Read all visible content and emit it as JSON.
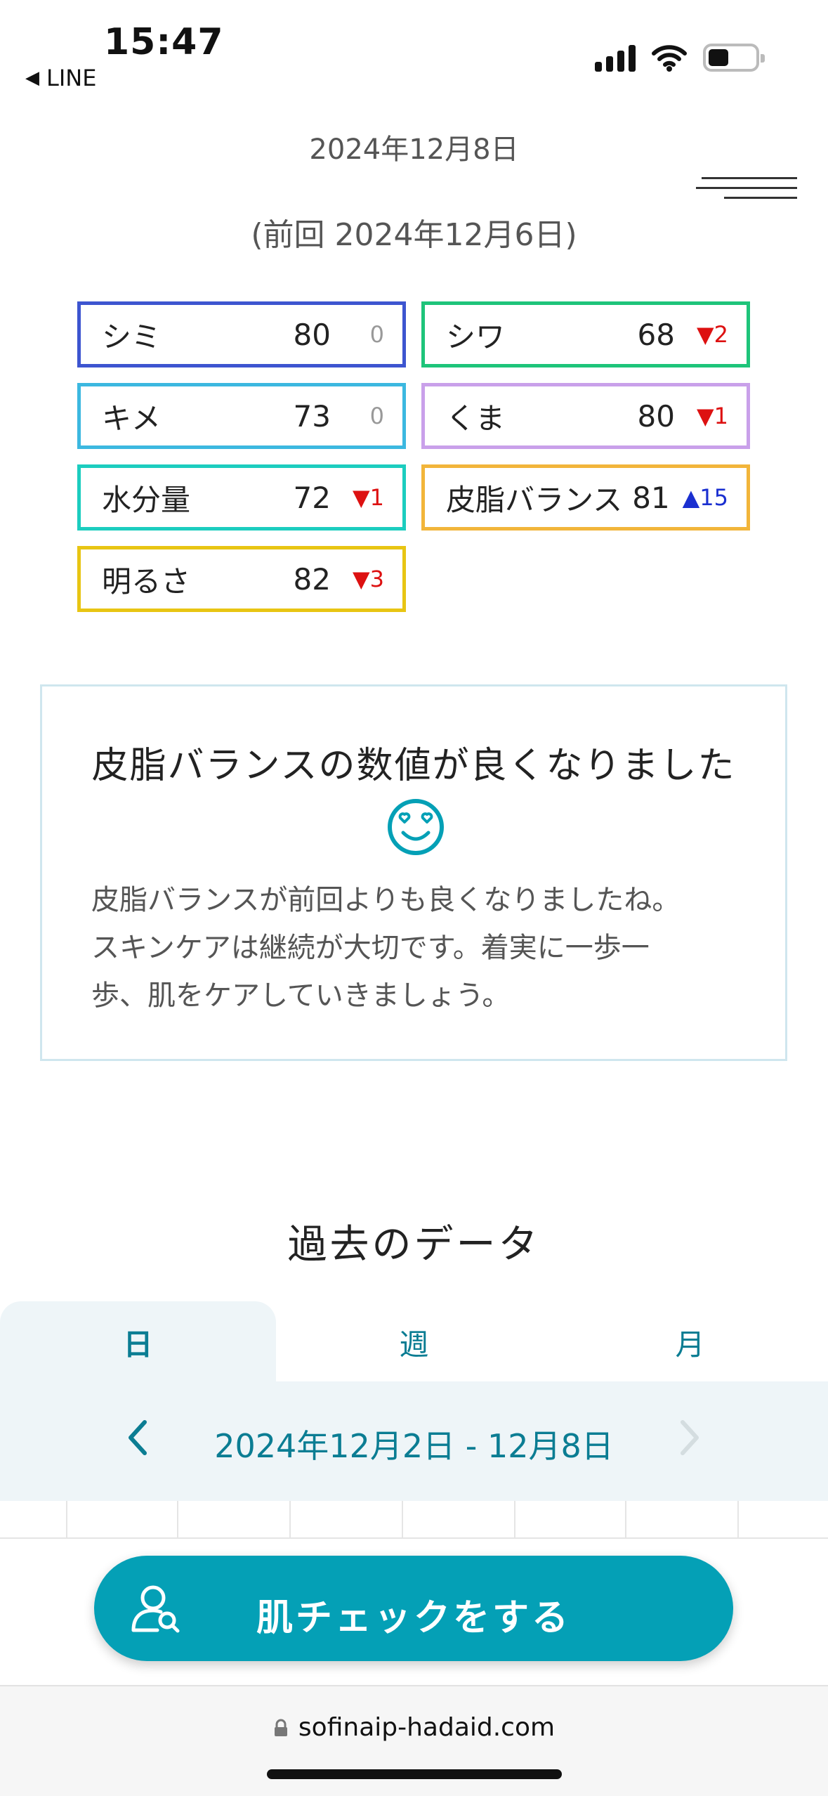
{
  "status_bar": {
    "time": "15:47",
    "back_app": "LINE",
    "back_icon": "triangle-left-icon",
    "icons": [
      "cellular-signal-icon",
      "wifi-icon",
      "battery-icon"
    ]
  },
  "header": {
    "date": "2024年12月8日",
    "previous": "(前回 2024年12月6日)",
    "menu_icon": "hamburger-menu-icon"
  },
  "scores": [
    {
      "label": "シミ",
      "value": "80",
      "change": "0",
      "direction": "none",
      "color": "#3d55d0"
    },
    {
      "label": "シワ",
      "value": "68",
      "change": "▼2",
      "direction": "down",
      "color": "#1ec47a"
    },
    {
      "label": "キメ",
      "value": "73",
      "change": "0",
      "direction": "none",
      "color": "#3cb8e0"
    },
    {
      "label": "くま",
      "value": "80",
      "change": "▼1",
      "direction": "down",
      "color": "#c9a0ea"
    },
    {
      "label": "水分量",
      "value": "72",
      "change": "▼1",
      "direction": "down",
      "color": "#1ccdbf"
    },
    {
      "label": "皮脂バランス",
      "value": "81",
      "change": "▲15",
      "direction": "up",
      "color": "#f2b53a"
    },
    {
      "label": "明るさ",
      "value": "82",
      "change": "▼3",
      "direction": "down",
      "color": "#e8c513"
    }
  ],
  "message": {
    "title": "皮脂バランスの数値が良くなりました",
    "emoji_icon": "heart-eyes-smile-icon",
    "body_lines": [
      "皮脂バランスが前回よりも良くなりましたね。",
      "スキンケアは継続が大切です。着実に一歩一",
      "歩、肌をケアしていきましょう。"
    ]
  },
  "past_data": {
    "title": "過去のデータ",
    "tabs": [
      "日",
      "週",
      "月"
    ],
    "active_tab": "日",
    "range": "2024年12月2日 - 12月8日",
    "prev_icon": "chevron-left-icon",
    "next_icon": "chevron-right-icon"
  },
  "cta": {
    "label": "肌チェックをする",
    "icon": "user-search-icon"
  },
  "browser": {
    "url": "sofinaip-hadaid.com",
    "lock_icon": "lock-icon"
  },
  "colors": {
    "accent": "#04a0b6",
    "accent_text": "#0b7d93",
    "up": "#1a2fd0",
    "down": "#dd1111"
  }
}
